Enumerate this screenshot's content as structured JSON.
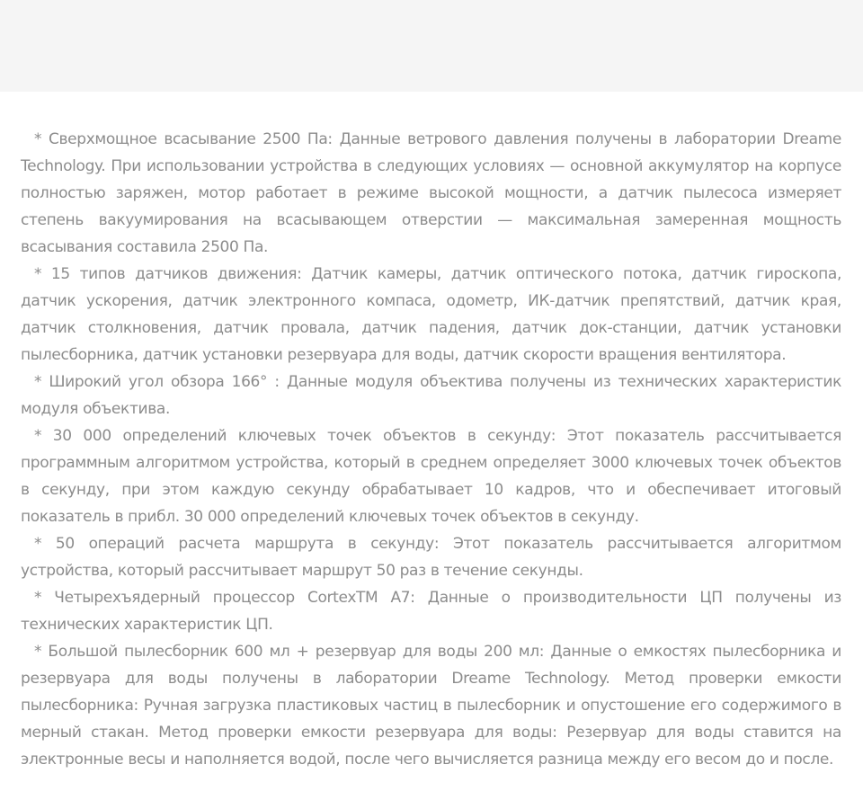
{
  "notes": [
    "* Сверхмощное всасывание 2500 Па: Данные ветрового давления получены в лаборатории Dreame Technology. При использовании устройства в следующих условиях — основной аккумулятор на корпусе полностью заряжен, мотор работает в режиме высокой мощности, а датчик пылесоса измеряет степень вакуумирования на всасывающем отверстии — максимальная замеренная мощность всасывания составила 2500 Па.",
    "* 15 типов датчиков движения: Датчик камеры, датчик оптического потока, датчик гироскопа, датчик ускорения, датчик электронного компаса, одометр, ИК-датчик препятствий, датчик края, датчик столкновения, датчик провала, датчик падения, датчик док-станции, датчик установки пылесборника, датчик установки резервуара для воды, датчик скорости вращения вентилятора.",
    "* Широкий угол обзора 166° : Данные модуля объектива получены из технических характеристик модуля объектива.",
    "* 30 000 определений ключевых точек объектов в секунду: Этот показатель рассчитывается программным алгоритмом устройства, который в среднем определяет 3000 ключевых точек объектов в секунду, при этом каждую секунду обрабатывает 10 кадров, что и обеспечивает итоговый показатель в прибл. 30 000 определений ключевых точек объектов в секунду.",
    "* 50 операций расчета маршрута в секунду: Этот показатель рассчитывается алгоритмом устройства, который рассчитывает маршрут 50 раз в течение секунды.",
    "* Четырехъядерный процессор CortexTM A7: Данные о производительности ЦП получены из технических характеристик ЦП.",
    "* Большой пылесборник 600 мл + резервуар для воды 200 мл: Данные о емкостях пылесборника и резервуара для воды получены в лаборатории Dreame Technology. Метод проверки емкости пылесборника: Ручная загрузка пластиковых частиц в пылесборник и опустошение его содержимого в мерный стакан. Метод проверки емкости резервуара для воды: Резервуар для воды ставится на электронные весы и наполняется водой, после чего вычисляется разница между его весом до и после."
  ]
}
